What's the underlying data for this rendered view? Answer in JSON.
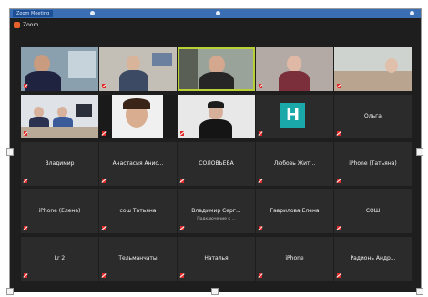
{
  "window": {
    "title": "Zoom Meeting",
    "app_name": "Zoom"
  },
  "participants": [
    {
      "name": "",
      "video": true,
      "active": false,
      "muted": true
    },
    {
      "name": "",
      "video": true,
      "active": false,
      "muted": true
    },
    {
      "name": "",
      "video": true,
      "active": true,
      "muted": false
    },
    {
      "name": "",
      "video": true,
      "active": false,
      "muted": true
    },
    {
      "name": "",
      "video": true,
      "active": false,
      "muted": true
    },
    {
      "name": "",
      "video": true,
      "active": false,
      "muted": true
    },
    {
      "name": "",
      "video": true,
      "active": false,
      "muted": true
    },
    {
      "name": "",
      "video": true,
      "active": false,
      "muted": true
    },
    {
      "name": "",
      "video": false,
      "avatar_letter": "H",
      "active": false,
      "muted": true
    },
    {
      "name": "Ольга",
      "video": false,
      "active": false,
      "muted": true
    },
    {
      "name": "Владимир",
      "video": false,
      "active": false,
      "muted": true
    },
    {
      "name": "Анастасия Анис...",
      "video": false,
      "active": false,
      "muted": true
    },
    {
      "name": "СОЛОВЬЕВА",
      "video": false,
      "active": false,
      "muted": true
    },
    {
      "name": "Любовь Жит...",
      "video": false,
      "active": false,
      "muted": true
    },
    {
      "name": "iPhone (Татьяна)",
      "video": false,
      "active": false,
      "muted": true
    },
    {
      "name": "iPhone (Елена)",
      "video": false,
      "active": false,
      "muted": true
    },
    {
      "name": "сош Татьяна",
      "video": false,
      "active": false,
      "muted": true
    },
    {
      "name": "Владимир Серг...",
      "sub": "Подключение к ...",
      "video": false,
      "active": false,
      "muted": true
    },
    {
      "name": "Гаврилова Елена",
      "video": false,
      "active": false,
      "muted": true
    },
    {
      "name": "СОШ",
      "video": false,
      "active": false,
      "muted": true
    },
    {
      "name": "Lr 2",
      "video": false,
      "active": false,
      "muted": true
    },
    {
      "name": "Тельманчаты",
      "video": false,
      "active": false,
      "muted": true
    },
    {
      "name": "Наталья",
      "video": false,
      "active": false,
      "muted": true
    },
    {
      "name": "iPhone",
      "video": false,
      "active": false,
      "muted": true
    },
    {
      "name": "Радионь Андр...",
      "video": false,
      "active": false,
      "muted": true
    }
  ],
  "colors": {
    "background": "#1e1e1e",
    "tile": "#2b2b2b",
    "active_speaker": "#b9d134",
    "muted": "#e02b2b",
    "title_bar": "#3a6fb5"
  }
}
